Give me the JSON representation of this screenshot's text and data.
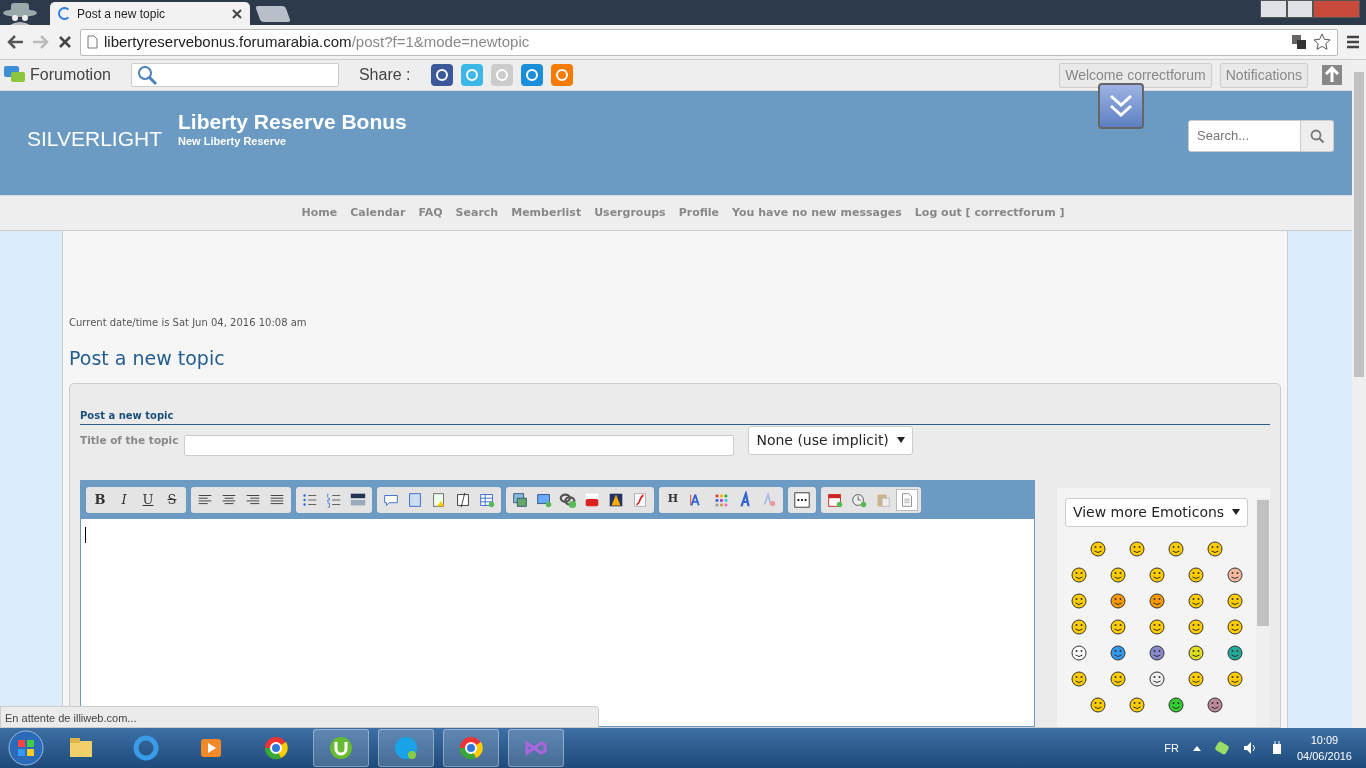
{
  "browser": {
    "tab": {
      "title": "Post a new topic"
    },
    "address": {
      "host": "libertyreservebonus.forumarabia.com",
      "path": "/post?f=1&mode=newtopic"
    }
  },
  "forumotion_bar": {
    "brand": "Forumotion",
    "share_label": "Share :",
    "welcome": "Welcome correctforum",
    "notifications": "Notifications"
  },
  "header": {
    "logo": "SILVERLIGHT",
    "title": "Liberty Reserve Bonus",
    "subtitle": "New Liberty Reserve",
    "search_placeholder": "Search..."
  },
  "nav": [
    "Home",
    "Calendar",
    "FAQ",
    "Search",
    "Memberlist",
    "Usergroups",
    "Profile",
    "You have no new messages",
    "Log out [ correctforum ]"
  ],
  "current_time": "Current date/time is Sat Jun 04, 2016 10:08 am",
  "page_title": "Post a new topic",
  "form": {
    "section_title": "Post a new topic",
    "title_label": "Title of the topic",
    "icon_select": "None (use implicit)",
    "toolbar_letters": [
      "B",
      "I",
      "U",
      "S",
      "H"
    ],
    "emoticon_select": "View more Emoticons"
  },
  "status_text": "En attente de illiweb.com...",
  "taskbar": {
    "language": "FR",
    "time": "10:09",
    "date": "04/06/2016"
  }
}
